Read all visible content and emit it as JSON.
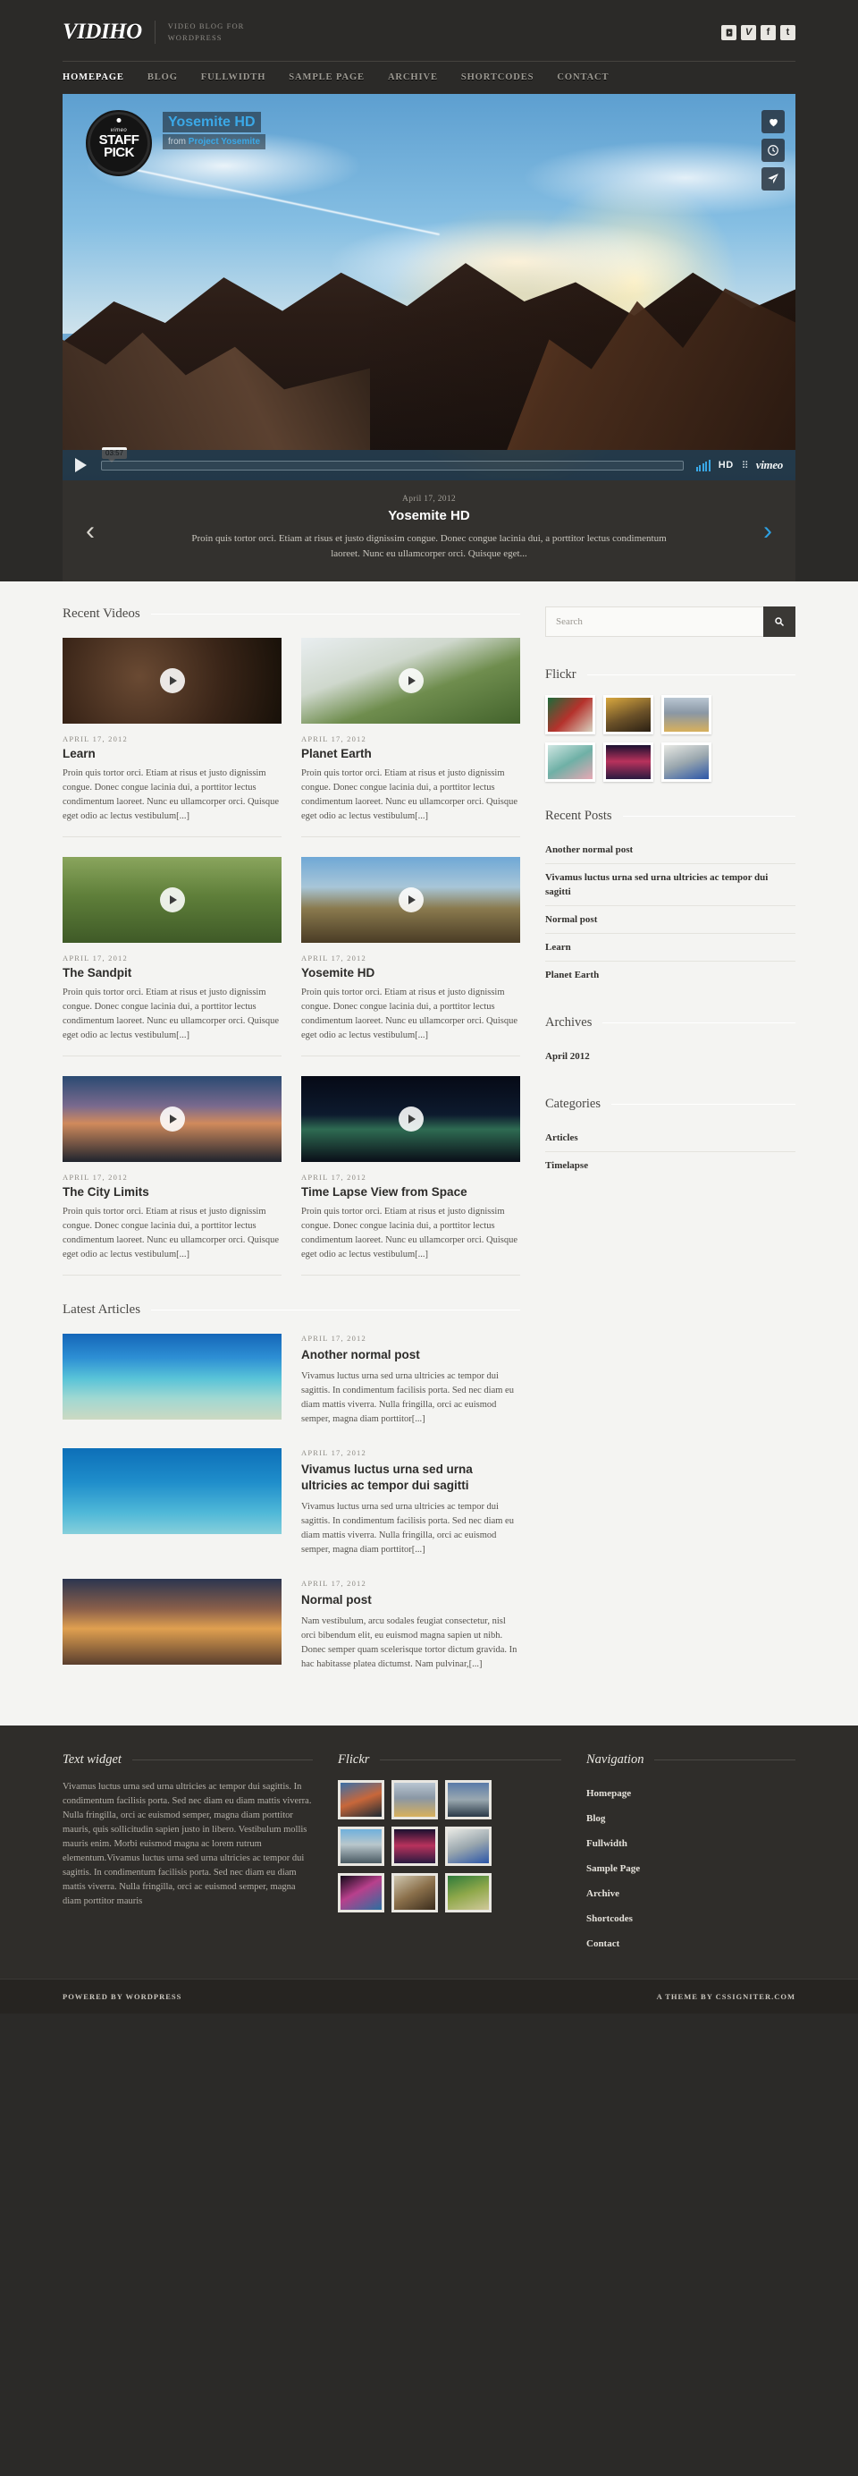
{
  "header": {
    "logo": "VIDIHO",
    "tagline_line1": "VIDEO BLOG FOR",
    "tagline_line2": "WORDPRESS",
    "social": [
      {
        "name": "youtube-icon",
        "label": "YT"
      },
      {
        "name": "vimeo-icon",
        "label": "V"
      },
      {
        "name": "facebook-icon",
        "label": "f"
      },
      {
        "name": "twitter-icon",
        "label": "t"
      }
    ],
    "nav": [
      {
        "label": "Homepage",
        "active": true
      },
      {
        "label": "Blog",
        "active": false
      },
      {
        "label": "Fullwidth",
        "active": false
      },
      {
        "label": "Sample Page",
        "active": false
      },
      {
        "label": "Archive",
        "active": false
      },
      {
        "label": "Shortcodes",
        "active": false
      },
      {
        "label": "Contact",
        "active": false
      }
    ]
  },
  "player": {
    "badge_vimeo": "vimeo",
    "badge_line1": "STAFF",
    "badge_line2": "PICK",
    "video_title": "Yosemite HD",
    "video_from_prefix": "from ",
    "video_author": "Project Yosemite",
    "time": "03:57",
    "hd_label": "HD",
    "vimeo_label": "vimeo",
    "overlay_buttons": [
      {
        "name": "heart-icon"
      },
      {
        "name": "clock-icon"
      },
      {
        "name": "share-icon"
      }
    ]
  },
  "slider_caption": {
    "date": "April 17, 2012",
    "title": "Yosemite HD",
    "excerpt": "Proin quis tortor orci. Etiam at risus et justo dignissim congue. Donec congue lacinia dui, a porttitor lectus condimentum laoreet. Nunc eu ullamcorper orci. Quisque eget...",
    "prev": "‹",
    "next": "›"
  },
  "main": {
    "recent_videos_title": "Recent Videos",
    "latest_articles_title": "Latest Articles",
    "videos": [
      {
        "date": "April 17, 2012",
        "title": "Learn",
        "excerpt": "Proin quis tortor orci. Etiam at risus et justo dignissim congue. Donec congue lacinia dui, a porttitor lectus condimentum laoreet. Nunc eu ullamcorper orci. Quisque eget odio ac lectus vestibulum[...]",
        "thumb_class": "t-learn"
      },
      {
        "date": "April 17, 2012",
        "title": "Planet Earth",
        "excerpt": "Proin quis tortor orci. Etiam at risus et justo dignissim congue. Donec congue lacinia dui, a porttitor lectus condimentum laoreet. Nunc eu ullamcorper orci. Quisque eget odio ac lectus vestibulum[...]",
        "thumb_class": "t-planet"
      },
      {
        "date": "April 17, 2012",
        "title": "The Sandpit",
        "excerpt": "Proin quis tortor orci. Etiam at risus et justo dignissim congue. Donec congue lacinia dui, a porttitor lectus condimentum laoreet. Nunc eu ullamcorper orci. Quisque eget odio ac lectus vestibulum[...]",
        "thumb_class": "t-sandpit"
      },
      {
        "date": "April 17, 2012",
        "title": "Yosemite HD",
        "excerpt": "Proin quis tortor orci. Etiam at risus et justo dignissim congue. Donec congue lacinia dui, a porttitor lectus condimentum laoreet. Nunc eu ullamcorper orci. Quisque eget odio ac lectus vestibulum[...]",
        "thumb_class": "t-yose"
      },
      {
        "date": "April 17, 2012",
        "title": "The City Limits",
        "excerpt": "Proin quis tortor orci. Etiam at risus et justo dignissim congue. Donec congue lacinia dui, a porttitor lectus condimentum laoreet. Nunc eu ullamcorper orci. Quisque eget odio ac lectus vestibulum[...]",
        "thumb_class": "t-city"
      },
      {
        "date": "April 17, 2012",
        "title": "Time Lapse View from Space",
        "excerpt": "Proin quis tortor orci. Etiam at risus et justo dignissim congue. Donec congue lacinia dui, a porttitor lectus condimentum laoreet. Nunc eu ullamcorper orci. Quisque eget odio ac lectus vestibulum[...]",
        "thumb_class": "t-space"
      }
    ],
    "articles": [
      {
        "date": "April 17, 2012",
        "title": "Another normal post",
        "excerpt": "Vivamus luctus urna sed urna ultricies ac tempor dui sagittis. In condimentum facilisis porta. Sed nec diam eu diam mattis viverra. Nulla fringilla, orci ac euismod semper, magna diam porttitor[...]",
        "thumb_class": "t-beach"
      },
      {
        "date": "April 17, 2012",
        "title": "Vivamus luctus urna sed urna ultricies ac tempor dui sagitti",
        "excerpt": "Vivamus luctus urna sed urna ultricies ac tempor dui sagittis. In condimentum facilisis porta. Sed nec diam eu diam mattis viverra. Nulla fringilla, orci ac euismod semper, magna diam porttitor[...]",
        "thumb_class": "t-sea"
      },
      {
        "date": "April 17, 2012",
        "title": "Normal post",
        "excerpt": "Nam vestibulum, arcu sodales feugiat consectetur, nisl orci bibendum elit, eu euismod magna sapien ut nibh. Donec semper quam scelerisque tortor dictum gravida. In hac habitasse platea dictumst. Nam pulvinar,[...]",
        "thumb_class": "t-sunset"
      }
    ]
  },
  "sidebar": {
    "search_placeholder": "Search",
    "search_value": "",
    "flickr_title": "Flickr",
    "flickr_thumbs": [
      "f1",
      "f2",
      "f3",
      "f4",
      "f5",
      "f6"
    ],
    "recent_posts_title": "Recent Posts",
    "recent_posts": [
      "Another normal post",
      "Vivamus luctus urna sed urna ultricies ac tempor dui sagitti",
      "Normal post",
      "Learn",
      "Planet Earth"
    ],
    "archives_title": "Archives",
    "archives": [
      "April 2012"
    ],
    "categories_title": "Categories",
    "categories": [
      "Articles",
      "Timelapse"
    ]
  },
  "footer": {
    "text_widget_title": "Text widget",
    "text_widget_body": "Vivamus luctus urna sed urna ultricies ac tempor dui sagittis. In condimentum facilisis porta. Sed nec diam eu diam mattis viverra. Nulla fringilla, orci ac euismod semper, magna diam porttitor mauris, quis sollicitudin sapien justo in libero. Vestibulum mollis mauris enim. Morbi euismod magna ac lorem rutrum elementum.Vivamus luctus urna sed urna ultricies ac tempor dui sagittis. In condimentum facilisis porta. Sed nec diam eu diam mattis viverra. Nulla fringilla, orci ac euismod semper, magna diam porttitor mauris",
    "flickr_title": "Flickr",
    "flickr_thumbs": [
      "f7",
      "f3",
      "f11",
      "f8",
      "f5",
      "f6",
      "f9",
      "f10",
      "f12"
    ],
    "nav_title": "Navigation",
    "nav": [
      "Homepage",
      "Blog",
      "Fullwidth",
      "Sample Page",
      "Archive",
      "Shortcodes",
      "Contact"
    ],
    "powered_by": "Powered by WordPress",
    "credit": "A theme by cssigniter.com"
  },
  "colors": {
    "dark_bg": "#2b2a28",
    "body_bg": "#f4f4f2",
    "accent_blue": "#2d9fe0",
    "vimeo_blue": "#3ba9e8"
  }
}
